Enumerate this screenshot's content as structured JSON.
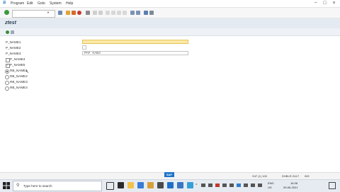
{
  "menubar": {
    "items": [
      "Program",
      "Edit",
      "Goto",
      "System",
      "Help"
    ]
  },
  "toolbar": {
    "command_value": ""
  },
  "title": "ztest",
  "form": {
    "params": [
      {
        "label": "P_NAME1",
        "value": ""
      },
      {
        "label": "P_NAME2",
        "value": ""
      },
      {
        "label": "P_NAME3",
        "value": "PAF  XAB2"
      }
    ],
    "checkbox1_label": "P_NAME4",
    "checkbox2_label": "P_NAME5",
    "radios": [
      "RB_NAME1",
      "RB_NAME2",
      "RB_NAME3",
      "RB_NAME4"
    ]
  },
  "statusbar": {
    "logo": "SAP",
    "system": "S47 (1) 100",
    "server": "DHBLR-S417",
    "mode": "INS"
  },
  "taskbar": {
    "search_placeholder": "Type here to search",
    "lang_top": "ENG",
    "lang_bottom": "US",
    "time": "16:38",
    "date": "09-06-2021"
  },
  "colors": {
    "title_bg": "#e4eaf1",
    "active_field": "#fbe9a7",
    "sap_blue": "#1a73c7"
  }
}
